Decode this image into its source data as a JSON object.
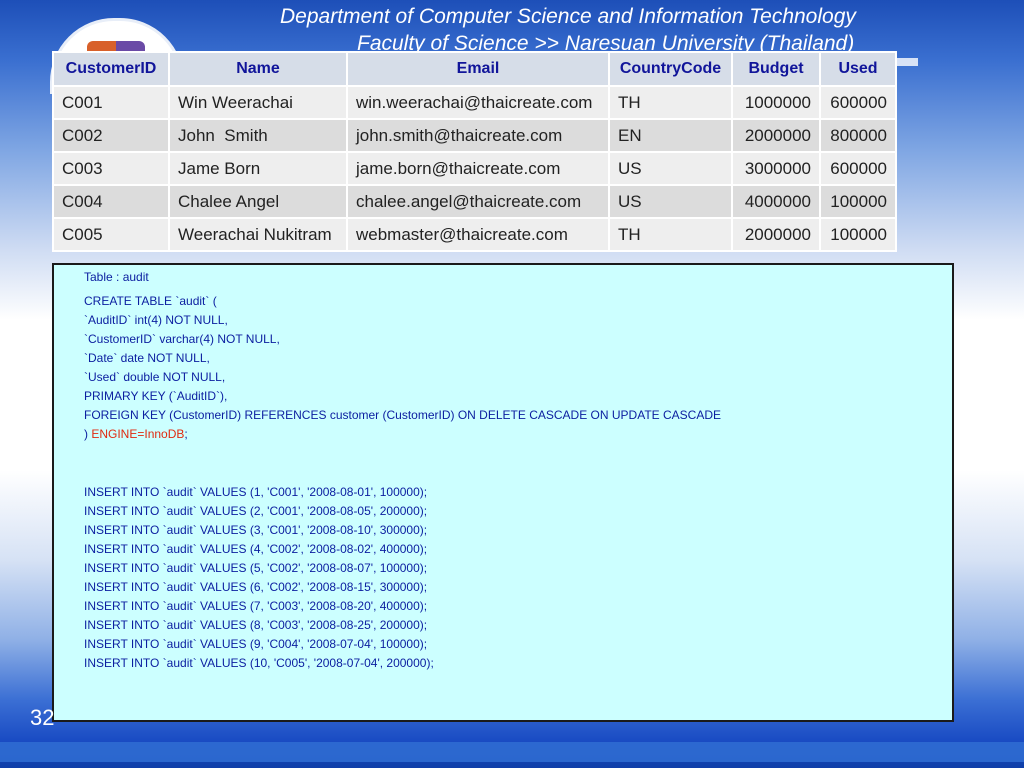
{
  "header": {
    "line1": "Department of Computer Science and Information Technology",
    "line2": "Faculty of Science >> Naresuan University (Thailand)"
  },
  "table": {
    "columns": [
      "CustomerID",
      "Name",
      "Email",
      "CountryCode",
      "Budget",
      "Used"
    ],
    "rows": [
      [
        "C001",
        "Win Weerachai",
        "win.weerachai@thaicreate.com",
        "TH",
        "1000000",
        "600000"
      ],
      [
        "C002",
        "John  Smith",
        "john.smith@thaicreate.com",
        "EN",
        "2000000",
        "800000"
      ],
      [
        "C003",
        "Jame Born",
        "jame.born@thaicreate.com",
        "US",
        "3000000",
        "600000"
      ],
      [
        "C004",
        "Chalee Angel",
        "chalee.angel@thaicreate.com",
        "US",
        "4000000",
        "100000"
      ],
      [
        "C005",
        "Weerachai Nukitram",
        "webmaster@thaicreate.com",
        "TH",
        "2000000",
        "100000"
      ]
    ]
  },
  "code": {
    "caption": "Table : audit",
    "create": [
      "CREATE TABLE `audit` (",
      "`AuditID` int(4) NOT NULL,",
      "`CustomerID` varchar(4) NOT NULL,",
      "`Date` date NOT NULL,",
      "`Used` double NOT NULL,",
      "PRIMARY KEY (`AuditID`),",
      "FOREIGN KEY (CustomerID) REFERENCES customer (CustomerID) ON DELETE CASCADE ON UPDATE CASCADE"
    ],
    "closing_prefix": ") ",
    "engine": "ENGINE=InnoDB",
    "closing_suffix": ";",
    "inserts": [
      "INSERT INTO `audit` VALUES (1, 'C001', '2008-08-01', 100000);",
      "INSERT INTO `audit` VALUES (2, 'C001', '2008-08-05', 200000);",
      "INSERT INTO `audit` VALUES (3, 'C001', '2008-08-10', 300000);",
      "INSERT INTO `audit` VALUES (4, 'C002', '2008-08-02', 400000);",
      "INSERT INTO `audit` VALUES (5, 'C002', '2008-08-07', 100000);",
      "INSERT INTO `audit` VALUES (6, 'C002', '2008-08-15', 300000);",
      "INSERT INTO `audit` VALUES (7, 'C003', '2008-08-20', 400000);",
      "INSERT INTO `audit` VALUES (8, 'C003', '2008-08-25', 200000);",
      "INSERT INTO `audit` VALUES (9, 'C004', '2008-07-04', 100000);",
      "INSERT INTO `audit` VALUES (10, 'C005', '2008-07-04', 200000);"
    ]
  },
  "slide_number": "32"
}
